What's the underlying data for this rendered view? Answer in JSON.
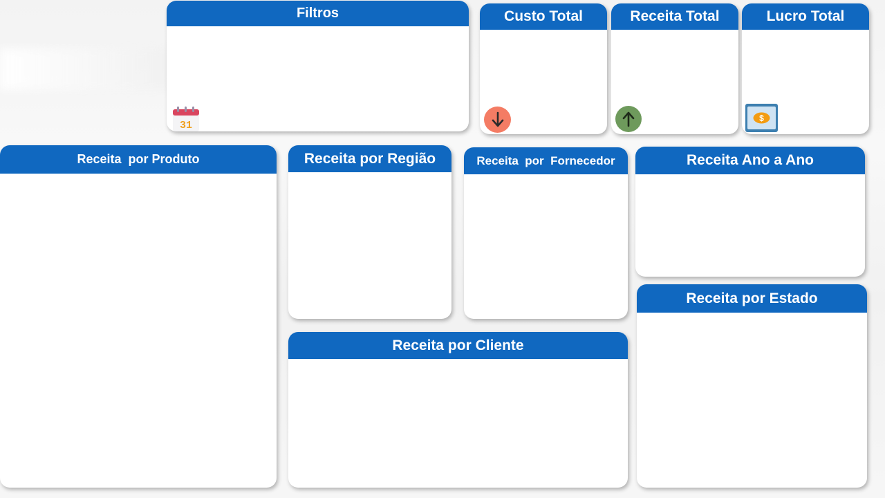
{
  "cards": {
    "filtros": {
      "title": "Filtros",
      "calendar_day": "31"
    },
    "custo_total": {
      "title": "Custo Total"
    },
    "receita_total": {
      "title": "Receita Total"
    },
    "lucro_total": {
      "title": "Lucro Total"
    },
    "receita_produto": {
      "title": "Receita  por Produto"
    },
    "receita_regiao": {
      "title": "Receita por Região"
    },
    "receita_fornecedor": {
      "title": "Receita  por  Fornecedor"
    },
    "receita_ano": {
      "title": "Receita Ano a Ano"
    },
    "receita_estado": {
      "title": "Receita por Estado"
    },
    "receita_cliente": {
      "title": "Receita por Cliente"
    }
  },
  "icons": {
    "calendar": "calendar-icon",
    "down": "arrow-down-icon",
    "up": "arrow-up-icon",
    "money": "money-icon"
  },
  "colors": {
    "header_blue": "#1068c0",
    "down_circle": "#f47c64",
    "up_circle": "#6e9a5c",
    "calendar_red": "#d9455f",
    "calendar_digit": "#f0a020",
    "money_coin": "#f39c12"
  }
}
